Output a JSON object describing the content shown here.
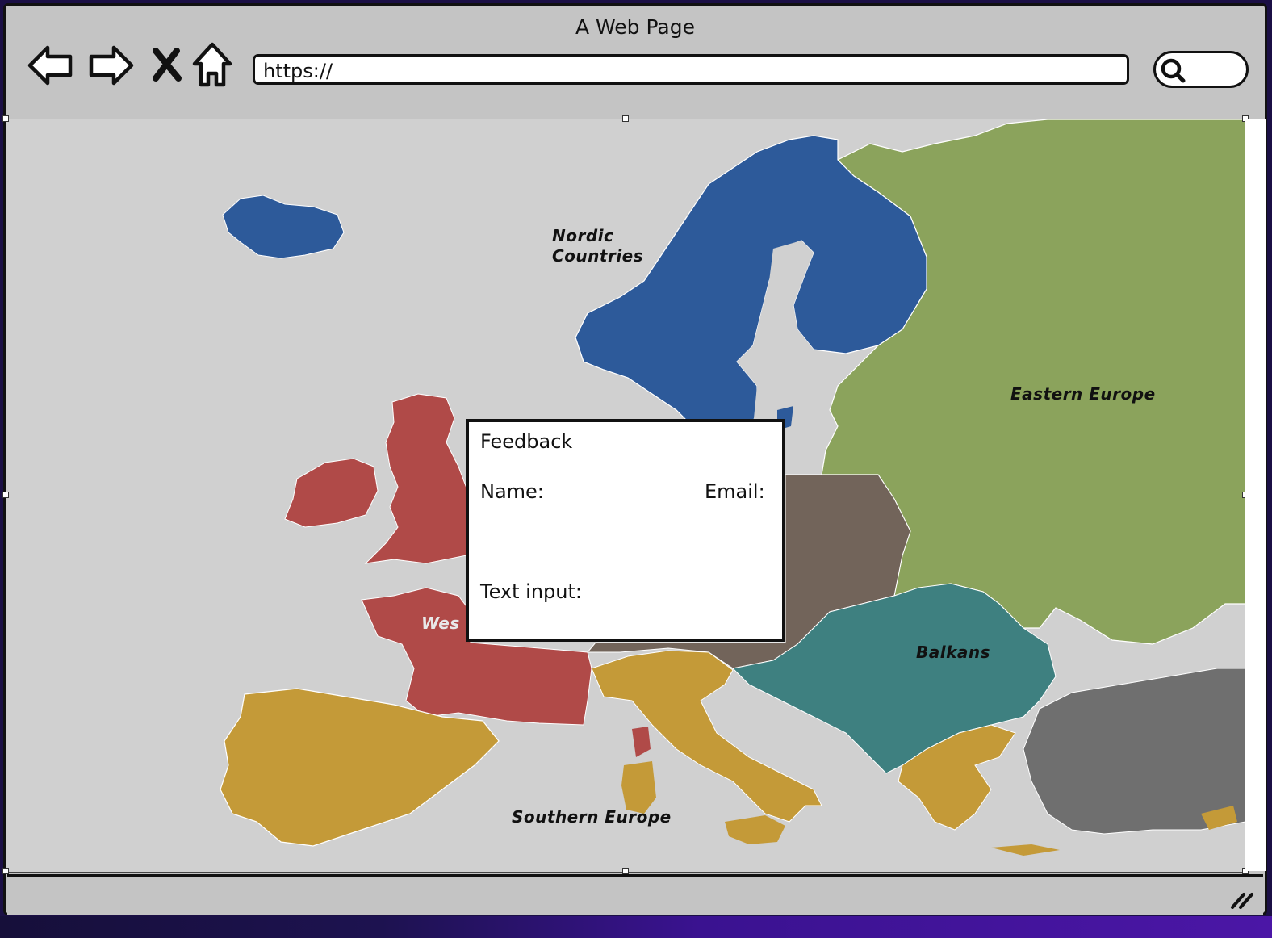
{
  "window": {
    "title": "A Web Page"
  },
  "toolbar": {
    "back_icon": "back-arrow-icon",
    "forward_icon": "forward-arrow-icon",
    "stop_icon": "close-x-icon",
    "home_icon": "home-icon",
    "url": "https://",
    "search_icon": "magnifier-icon"
  },
  "map": {
    "labels": {
      "nordic_line1": "Nordic",
      "nordic_line2": "Countries",
      "eastern": "Eastern Europe",
      "western": "Wes",
      "balkans": "Balkans",
      "southern": "Southern Europe"
    },
    "colors": {
      "sea": "#d0d0d0",
      "nordic": "#2d5a9a",
      "eastern": "#8ba35c",
      "western": "#b04a48",
      "central": "#72645a",
      "balkans": "#3e8080",
      "southern": "#c49a38",
      "turkey": "#6f6f6f"
    }
  },
  "feedback": {
    "title": "Feedback",
    "name_label": "Name:",
    "email_label": "Email:",
    "text_label": "Text input:"
  }
}
